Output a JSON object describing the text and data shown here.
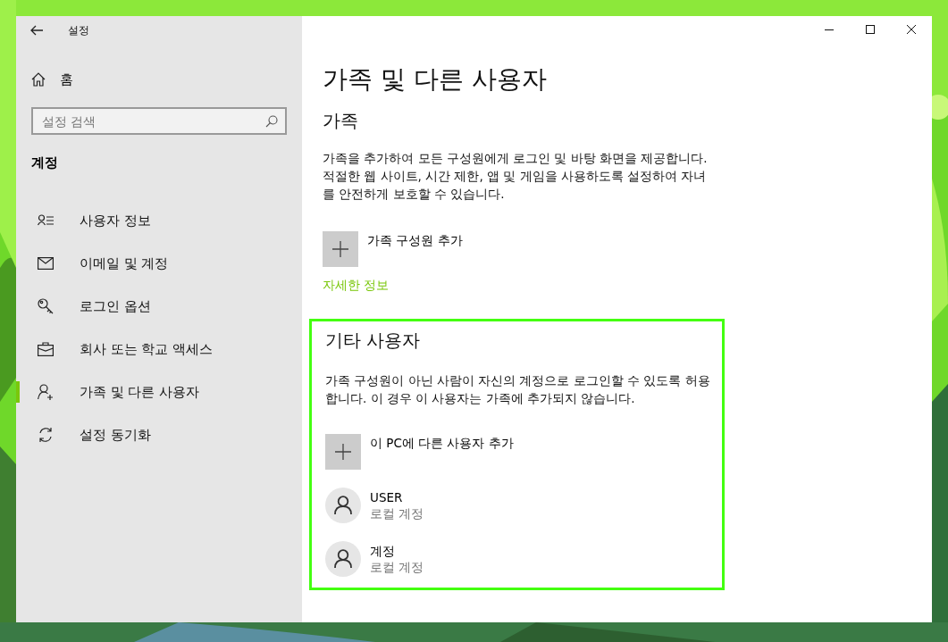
{
  "window": {
    "title": "설정"
  },
  "sidebar": {
    "home": "홈",
    "search": {
      "placeholder": "설정 검색"
    },
    "section": "계정",
    "items": [
      {
        "label": "사용자 정보",
        "selected": false
      },
      {
        "label": "이메일 및 계정",
        "selected": false
      },
      {
        "label": "로그인 옵션",
        "selected": false
      },
      {
        "label": "회사 또는 학교 액세스",
        "selected": false
      },
      {
        "label": "가족 및 다른 사용자",
        "selected": true
      },
      {
        "label": "설정 동기화",
        "selected": false
      }
    ]
  },
  "content": {
    "title": "가족 및 다른 사용자",
    "family": {
      "heading": "가족",
      "description": "가족을 추가하여 모든 구성원에게 로그인 및 바탕 화면을 제공합니다. 적절한 웹 사이트, 시간 제한, 앱 및 게임을 사용하도록 설정하여 자녀를 안전하게 보호할 수 있습니다.",
      "add_button": "가족 구성원 추가",
      "link": "자세한 정보"
    },
    "other_users": {
      "highlighted": true,
      "heading": "기타 사용자",
      "description": "가족 구성원이 아닌 사람이 자신의 계정으로 로그인할 수 있도록 허용합니다. 이 경우 이 사용자는 가족에 추가되지 않습니다.",
      "add_button": "이 PC에 다른 사용자 추가",
      "users": [
        {
          "name": "USER",
          "account_type": "로컬 계정"
        },
        {
          "name": "계정",
          "account_type": "로컬 계정"
        }
      ]
    }
  }
}
